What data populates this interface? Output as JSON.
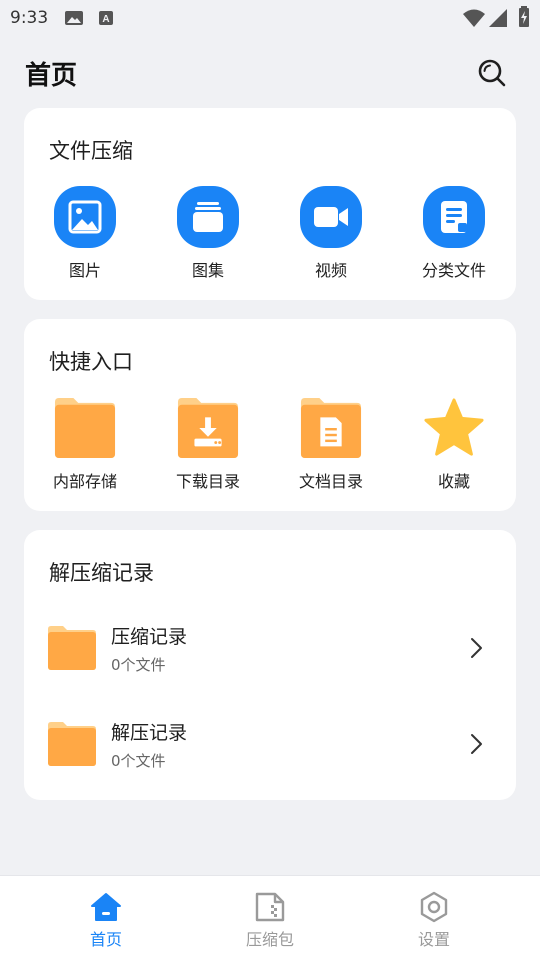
{
  "status_bar": {
    "time": "9:33"
  },
  "header": {
    "title": "首页"
  },
  "compress_card": {
    "title": "文件压缩",
    "items": [
      {
        "label": "图片",
        "icon": "image-icon"
      },
      {
        "label": "图集",
        "icon": "album-icon"
      },
      {
        "label": "视频",
        "icon": "video-icon"
      },
      {
        "label": "分类文件",
        "icon": "document-icon"
      }
    ]
  },
  "shortcut_card": {
    "title": "快捷入口",
    "items": [
      {
        "label": "内部存储",
        "icon": "folder-icon"
      },
      {
        "label": "下载目录",
        "icon": "download-folder-icon"
      },
      {
        "label": "文档目录",
        "icon": "document-folder-icon"
      },
      {
        "label": "收藏",
        "icon": "star-icon"
      }
    ]
  },
  "records_card": {
    "title": "解压缩记录",
    "rows": [
      {
        "title": "压缩记录",
        "subtitle": "0个文件"
      },
      {
        "title": "解压记录",
        "subtitle": "0个文件"
      }
    ]
  },
  "bottom_nav": {
    "items": [
      {
        "label": "首页",
        "icon": "home-icon",
        "active": true
      },
      {
        "label": "压缩包",
        "icon": "archive-icon",
        "active": false
      },
      {
        "label": "设置",
        "icon": "settings-icon",
        "active": false
      }
    ]
  },
  "colors": {
    "accent": "#1a84f6",
    "folder": "#ffa845",
    "star": "#ffc43d",
    "background": "#f0f1f4"
  }
}
